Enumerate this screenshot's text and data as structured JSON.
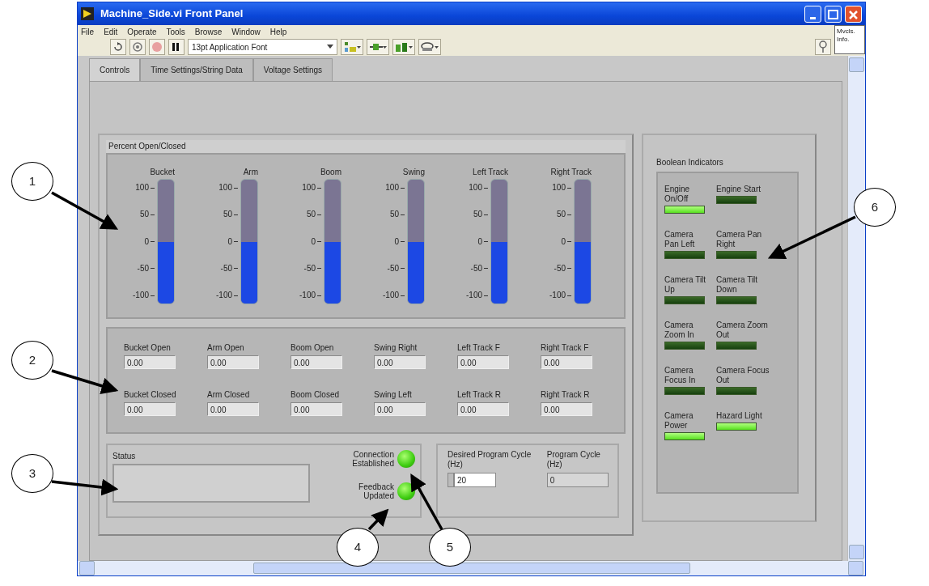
{
  "window": {
    "title": "Machine_Side.vi Front Panel"
  },
  "menu": [
    "File",
    "Edit",
    "Operate",
    "Tools",
    "Browse",
    "Window",
    "Help"
  ],
  "toolbar": {
    "font": "13pt Application Font",
    "vi_icon": "Mvcls. Info."
  },
  "tabs": [
    {
      "label": "Controls",
      "selected": true
    },
    {
      "label": "Time Settings/String Data",
      "selected": false
    },
    {
      "label": "Voltage Settings",
      "selected": false
    }
  ],
  "meters": {
    "title": "Percent Open/Closed",
    "items": [
      {
        "label": "Bucket",
        "ticks": [
          "100",
          "50",
          "0",
          "-50",
          "-100"
        ],
        "level": 0.5
      },
      {
        "label": "Arm",
        "ticks": [
          "100",
          "50",
          "0",
          "-50",
          "-100"
        ],
        "level": 0.5
      },
      {
        "label": "Boom",
        "ticks": [
          "100",
          "50",
          "0",
          "-50",
          "-100"
        ],
        "level": 0.5
      },
      {
        "label": "Swing",
        "ticks": [
          "100",
          "50",
          "0",
          "-50",
          "-100"
        ],
        "level": 0.5
      },
      {
        "label": "Left Track",
        "ticks": [
          "100",
          "50",
          "0",
          "-50",
          "-100"
        ],
        "level": 0.5
      },
      {
        "label": "Right Track",
        "ticks": [
          "100",
          "50",
          "0",
          "-50",
          "-100"
        ],
        "level": 0.5
      }
    ]
  },
  "numerics": [
    {
      "label": "Bucket Open",
      "value": "0.00"
    },
    {
      "label": "Arm Open",
      "value": "0.00"
    },
    {
      "label": "Boom Open",
      "value": "0.00"
    },
    {
      "label": "Swing Right",
      "value": "0.00"
    },
    {
      "label": "Left Track F",
      "value": "0.00"
    },
    {
      "label": "Right Track F",
      "value": "0.00"
    },
    {
      "label": "Bucket Closed",
      "value": "0.00"
    },
    {
      "label": "Arm Closed",
      "value": "0.00"
    },
    {
      "label": "Boom Closed",
      "value": "0.00"
    },
    {
      "label": "Swing Left",
      "value": "0.00"
    },
    {
      "label": "Left Track R",
      "value": "0.00"
    },
    {
      "label": "Right Track R",
      "value": "0.00"
    }
  ],
  "status": {
    "label": "Status",
    "leds": [
      {
        "label": "Connection Established",
        "on": true
      },
      {
        "label": "Feedback Updated",
        "on": true
      }
    ]
  },
  "cycle": {
    "desired": {
      "label": "Desired Program Cycle (Hz)",
      "value": "20"
    },
    "actual": {
      "label": "Program Cycle (Hz)",
      "value": "0"
    }
  },
  "booleans": {
    "title": "Boolean Indicators",
    "items": [
      {
        "label": "Engine On/Off",
        "on": true
      },
      {
        "label": "Engine Start",
        "on": false
      },
      {
        "label": "Camera Pan Left",
        "on": false
      },
      {
        "label": "Camera Pan Right",
        "on": false
      },
      {
        "label": "Camera Tilt Up",
        "on": false
      },
      {
        "label": "Camera Tilt Down",
        "on": false
      },
      {
        "label": "Camera Zoom In",
        "on": false
      },
      {
        "label": "Camera Zoom Out",
        "on": false
      },
      {
        "label": "Camera Focus In",
        "on": false
      },
      {
        "label": "Camera Focus Out",
        "on": false
      },
      {
        "label": "Camera Power",
        "on": true
      },
      {
        "label": "Hazard Light",
        "on": true
      }
    ]
  },
  "callouts": [
    "1",
    "2",
    "3",
    "4",
    "5",
    "6"
  ]
}
